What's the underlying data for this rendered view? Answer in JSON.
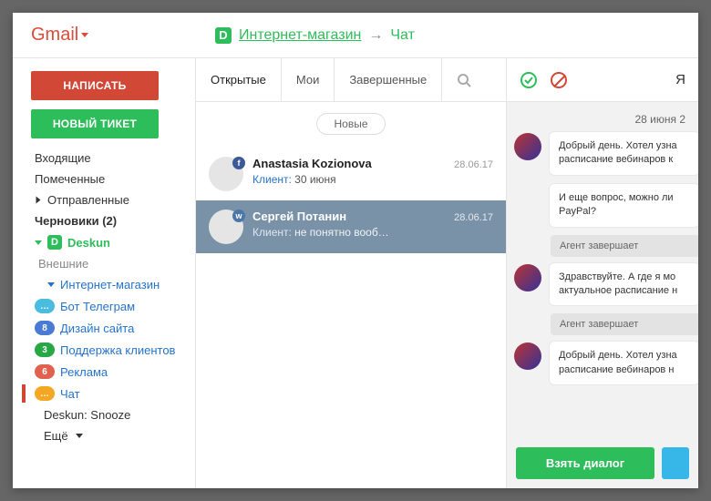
{
  "logo": "Gmail",
  "breadcrumb": {
    "store": "Интернет-магазин",
    "chat": "Чат"
  },
  "buttons": {
    "compose": "НАПИСАТЬ",
    "new_ticket": "НОВЫЙ ТИКЕТ"
  },
  "nav": {
    "inbox": "Входящие",
    "starred": "Помеченные",
    "sent": "Отправленные",
    "drafts": "Черновики (2)",
    "deskun": "Deskun",
    "external": "Внешние",
    "store": "Интернет-магазин",
    "telegram": "Бот Телеграм",
    "design": "Дизайн сайта",
    "support": "Поддержка клиентов",
    "ads": "Реклама",
    "chat": "Чат",
    "snooze": "Deskun: Snooze",
    "more": "Ещё",
    "counts": {
      "design": "8",
      "support": "3",
      "ads": "6"
    }
  },
  "tabs": {
    "open": "Открытые",
    "mine": "Мои",
    "done": "Завершенные"
  },
  "pill": "Новые",
  "conversations": [
    {
      "name": "Anastasia Kozionova",
      "date": "28.06.17",
      "label": "Клиент:",
      "preview": "30 июня",
      "social": "fb",
      "selected": false
    },
    {
      "name": "Сергей Потанин",
      "date": "28.06.17",
      "label": "Клиент:",
      "preview": "не понятно вооб…",
      "social": "vk",
      "selected": true
    }
  ],
  "chat": {
    "top_right": "Я",
    "date": "28 июня 2",
    "msg1": "Добрый день. Хотел узна расписание вебинаров к",
    "msg2": "И еще вопрос, можно ли PayPal?",
    "sys": "Агент завершает",
    "msg3": "Здравствуйте. А где я мо актуальное расписание н",
    "msg4": "Добрый день. Хотел узна расписание вебинаров н",
    "take": "Взять диалог"
  }
}
